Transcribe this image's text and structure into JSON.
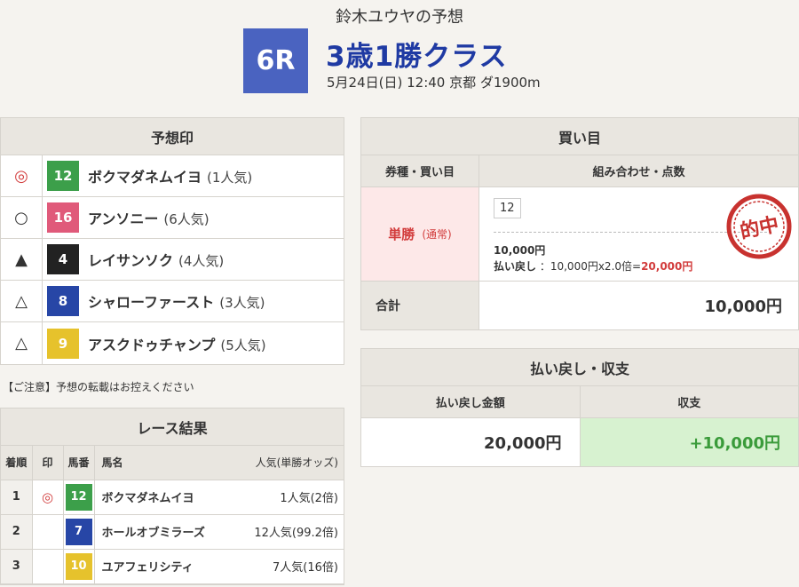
{
  "header": {
    "forecaster_title": "鈴木ユウヤの予想",
    "race_number": "6R",
    "race_name": "3歳1勝クラス",
    "race_info": "5月24日(日) 12:40 京都 ダ1900m"
  },
  "forecast": {
    "title": "予想印",
    "rows": [
      {
        "mark": "◎",
        "number": "12",
        "color": "#3c9f4a",
        "horse": "ボクマダネムイヨ",
        "popularity": "(1人気)"
      },
      {
        "mark": "○",
        "number": "16",
        "color": "#e05a7a",
        "horse": "アンソニー",
        "popularity": "(6人気)"
      },
      {
        "mark": "▲",
        "number": "4",
        "color": "#222222",
        "horse": "レイサンソク",
        "popularity": "(4人気)"
      },
      {
        "mark": "△",
        "number": "8",
        "color": "#2746a6",
        "horse": "シャローファースト",
        "popularity": "(3人気)"
      },
      {
        "mark": "△",
        "number": "9",
        "color": "#e6c22c",
        "horse": "アスクドゥチャンプ",
        "popularity": "(5人気)"
      }
    ]
  },
  "notice": "【ご注意】予想の転載はお控えください",
  "result": {
    "title": "レース結果",
    "headers": {
      "rank": "着順",
      "mark": "印",
      "number": "馬番",
      "name": "馬名",
      "odds": "人気(単勝オッズ)"
    },
    "rows": [
      {
        "rank": "1",
        "mark": "◎",
        "number": "12",
        "color": "#3c9f4a",
        "name": "ボクマダネムイヨ",
        "odds": "1人気(2倍)"
      },
      {
        "rank": "2",
        "mark": "",
        "number": "7",
        "color": "#2746a6",
        "name": "ホールオブミラーズ",
        "odds": "12人気(99.2倍)"
      },
      {
        "rank": "3",
        "mark": "",
        "number": "10",
        "color": "#e6c22c",
        "name": "ユアフェリシティ",
        "odds": "7人気(16倍)"
      }
    ]
  },
  "bets": {
    "title": "買い目",
    "header_type": "券種・買い目",
    "header_combo": "組み合わせ・点数",
    "type": "単勝",
    "type_sub": "(通常)",
    "combo": "12",
    "stake": "10,000円",
    "payout_label": "払い戻し",
    "payout_calc": "：10,000円x2.0倍=",
    "payout_result": "20,000円",
    "stamp_text": "的中",
    "total_label": "合計",
    "total_value": "10,000円"
  },
  "balance": {
    "title": "払い戻し・収支",
    "header_payout": "払い戻し金額",
    "header_balance": "収支",
    "payout": "20,000円",
    "profit": "+10,000円"
  }
}
